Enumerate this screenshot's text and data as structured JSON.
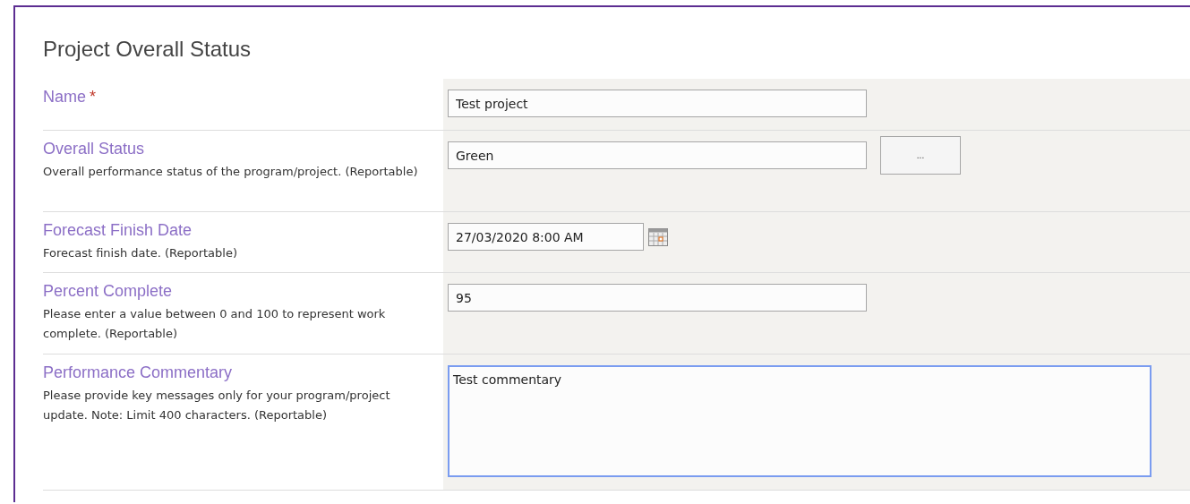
{
  "title": "Project Overall Status",
  "fields": [
    {
      "kind": "text",
      "label": "Name",
      "required_mark": "*",
      "value": "Test project"
    },
    {
      "kind": "lookup",
      "label": "Overall Status",
      "description": "Overall performance status of the program/project. (Reportable)",
      "value": "Green",
      "button": "..."
    },
    {
      "kind": "date",
      "label": "Forecast Finish Date",
      "description": "Forecast finish date. (Reportable)",
      "value": "27/03/2020 8:00 AM"
    },
    {
      "kind": "text",
      "label": "Percent Complete",
      "description": "Please enter a value between 0 and 100 to represent work complete. (Reportable)",
      "value": "95"
    },
    {
      "kind": "multiline",
      "label": "Performance Commentary",
      "description": "Please provide key messages only for your program/project update. Note: Limit 400 characters. (Reportable)",
      "value": "Test commentary",
      "focused": true
    }
  ]
}
